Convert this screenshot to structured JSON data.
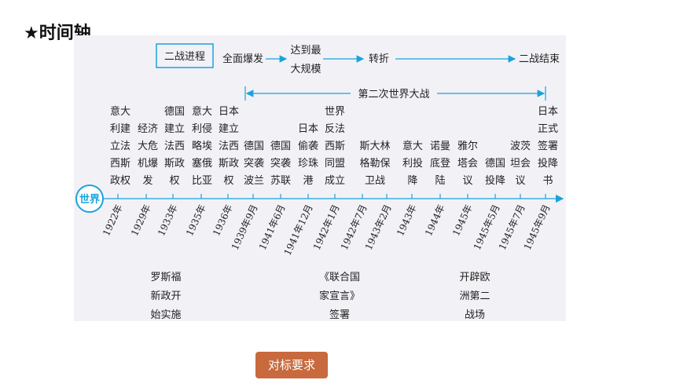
{
  "heading": "★时间轴",
  "progress": {
    "label": "二战进程",
    "stages": [
      "全面爆发",
      "达到最",
      "大规模",
      "转折",
      "二战结束"
    ]
  },
  "span_label": "第二次世界大战",
  "axis_label": "世界",
  "events": [
    {
      "year": "1922年",
      "text": [
        "意大",
        "利建",
        "立法",
        "西斯",
        "政权"
      ]
    },
    {
      "year": "1929年",
      "text": [
        "经济",
        "大危",
        "机爆",
        "发"
      ]
    },
    {
      "year": "1933年",
      "text": [
        "德国",
        "建立",
        "法西",
        "斯政",
        "权"
      ]
    },
    {
      "year": "1935年",
      "text": [
        "意大",
        "利侵",
        "略埃",
        "塞俄",
        "比亚"
      ]
    },
    {
      "year": "1936年",
      "text": [
        "日本",
        "建立",
        "法西",
        "斯政",
        "权"
      ]
    },
    {
      "year": "1939年9月",
      "text": [
        "德国",
        "突袭",
        "波兰"
      ]
    },
    {
      "year": "1941年6月",
      "text": [
        "德国",
        "突袭",
        "苏联"
      ]
    },
    {
      "year": "1941年12月",
      "text": [
        "日本",
        "偷袭",
        "珍珠",
        "港"
      ]
    },
    {
      "year": "1942年1月",
      "text": [
        "世界",
        "反法",
        "西斯",
        "同盟",
        "成立"
      ]
    },
    {
      "year": "1942年7月",
      "text": [
        "斯大林",
        "格勒保",
        "卫战"
      ]
    },
    {
      "year": "1943年2月",
      "text": []
    },
    {
      "year": "1943年",
      "text": [
        "意大",
        "利投",
        "降"
      ]
    },
    {
      "year": "1944年",
      "text": [
        "诺曼",
        "底登",
        "陆"
      ]
    },
    {
      "year": "1945年",
      "text": [
        "雅尔",
        "塔会",
        "议"
      ]
    },
    {
      "year": "1945年5月",
      "text": [
        "德国",
        "投降"
      ]
    },
    {
      "year": "1945年7月",
      "text": [
        "波茨",
        "坦会",
        "议"
      ]
    },
    {
      "year": "1945年9月",
      "text": [
        "日本",
        "正式",
        "签署",
        "投降",
        "书"
      ]
    }
  ],
  "below_notes": [
    {
      "lines": [
        "罗斯福",
        "新政开",
        "始实施"
      ]
    },
    {
      "lines": [
        "《联合国",
        "家宣言》",
        "签署"
      ]
    },
    {
      "lines": [
        "开辟欧",
        "洲第二",
        "战场"
      ]
    }
  ],
  "colors": {
    "accent": "#1aa3db",
    "button": "#c86a3d",
    "panel": "#f2f1f6"
  },
  "button_label": "对标要求"
}
